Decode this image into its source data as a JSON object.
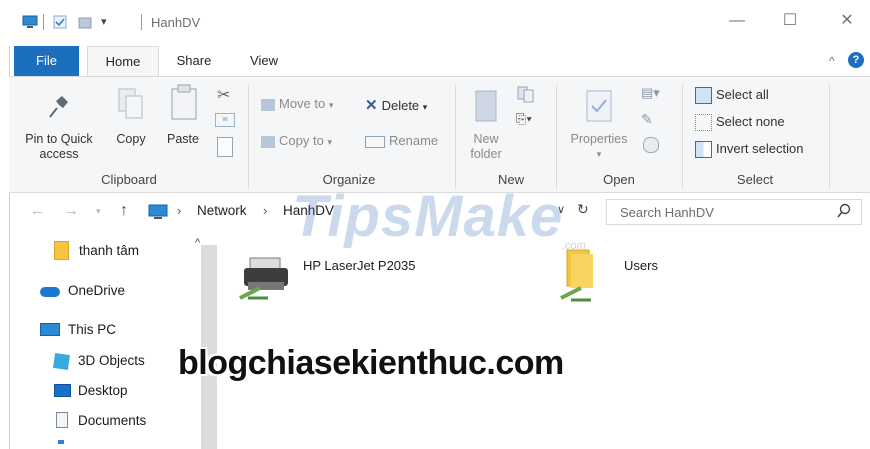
{
  "window": {
    "title": "HanhDV"
  },
  "tabs": {
    "file": "File",
    "home": "Home",
    "share": "Share",
    "view": "View"
  },
  "ribbon": {
    "clipboard": {
      "label": "Clipboard",
      "pin_line1": "Pin to Quick",
      "pin_line2": "access",
      "copy": "Copy",
      "paste": "Paste"
    },
    "organize": {
      "label": "Organize",
      "move_to": "Move to",
      "copy_to": "Copy to",
      "delete": "Delete",
      "rename": "Rename"
    },
    "new": {
      "label": "New",
      "new_folder_line1": "New",
      "new_folder_line2": "folder"
    },
    "open": {
      "label": "Open",
      "properties": "Properties"
    },
    "select": {
      "label": "Select",
      "select_all": "Select all",
      "select_none": "Select none",
      "invert": "Invert selection"
    }
  },
  "address": {
    "crumbs": [
      "Network",
      "HanhDV"
    ],
    "search_placeholder": "Search HanhDV"
  },
  "nav": {
    "items": [
      "thanh tâm",
      "OneDrive",
      "This PC",
      "3D Objects",
      "Desktop",
      "Documents"
    ]
  },
  "content": {
    "items": [
      "HP LaserJet P2035",
      "Users"
    ]
  },
  "watermarks": {
    "tipsmake": "TipsMake",
    "tipsmake_suffix": ".com",
    "blog": "blogchiasekienthuc.com"
  },
  "colors": {
    "accent": "#1c6fbf",
    "ribbon_bg": "#f5f6f7",
    "folder": "#f5c53e"
  }
}
